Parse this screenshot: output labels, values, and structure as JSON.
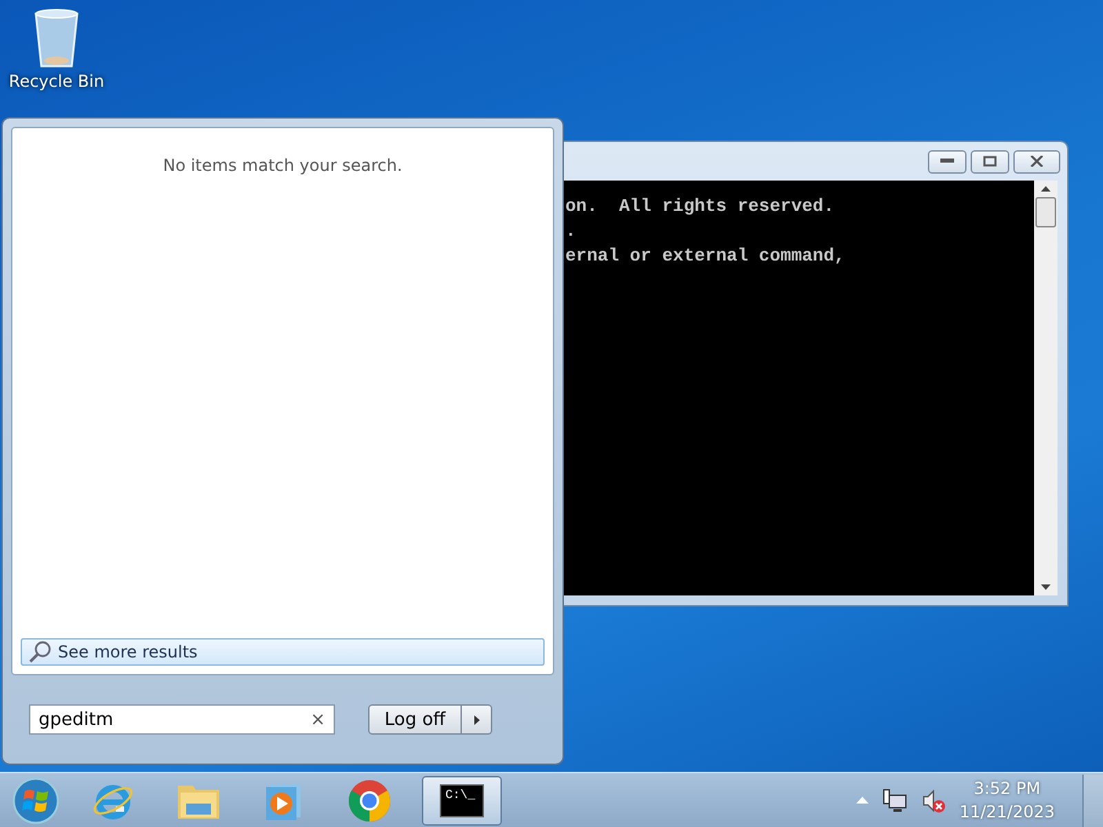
{
  "desktop_icons": [
    {
      "label": "Recycle Bin"
    }
  ],
  "console_window": {
    "lines": [
      "on.  All rights reserved.",
      ".",
      "ernal or external command,"
    ]
  },
  "start_menu": {
    "message": "No items match your search.",
    "see_more": "See more results",
    "search": {
      "value": "gpeditm",
      "clear": "×"
    },
    "log_off": "Log off"
  },
  "taskbar": {
    "items": [
      {
        "kind": "ie",
        "selected": false
      },
      {
        "kind": "folder",
        "selected": false
      },
      {
        "kind": "media",
        "selected": false
      },
      {
        "kind": "chrome",
        "selected": false
      },
      {
        "kind": "cmd",
        "selected": true
      }
    ],
    "cmd_icon_text": "C:\\_",
    "tray": {
      "time": "3:52 PM",
      "date": "11/21/2023"
    }
  }
}
